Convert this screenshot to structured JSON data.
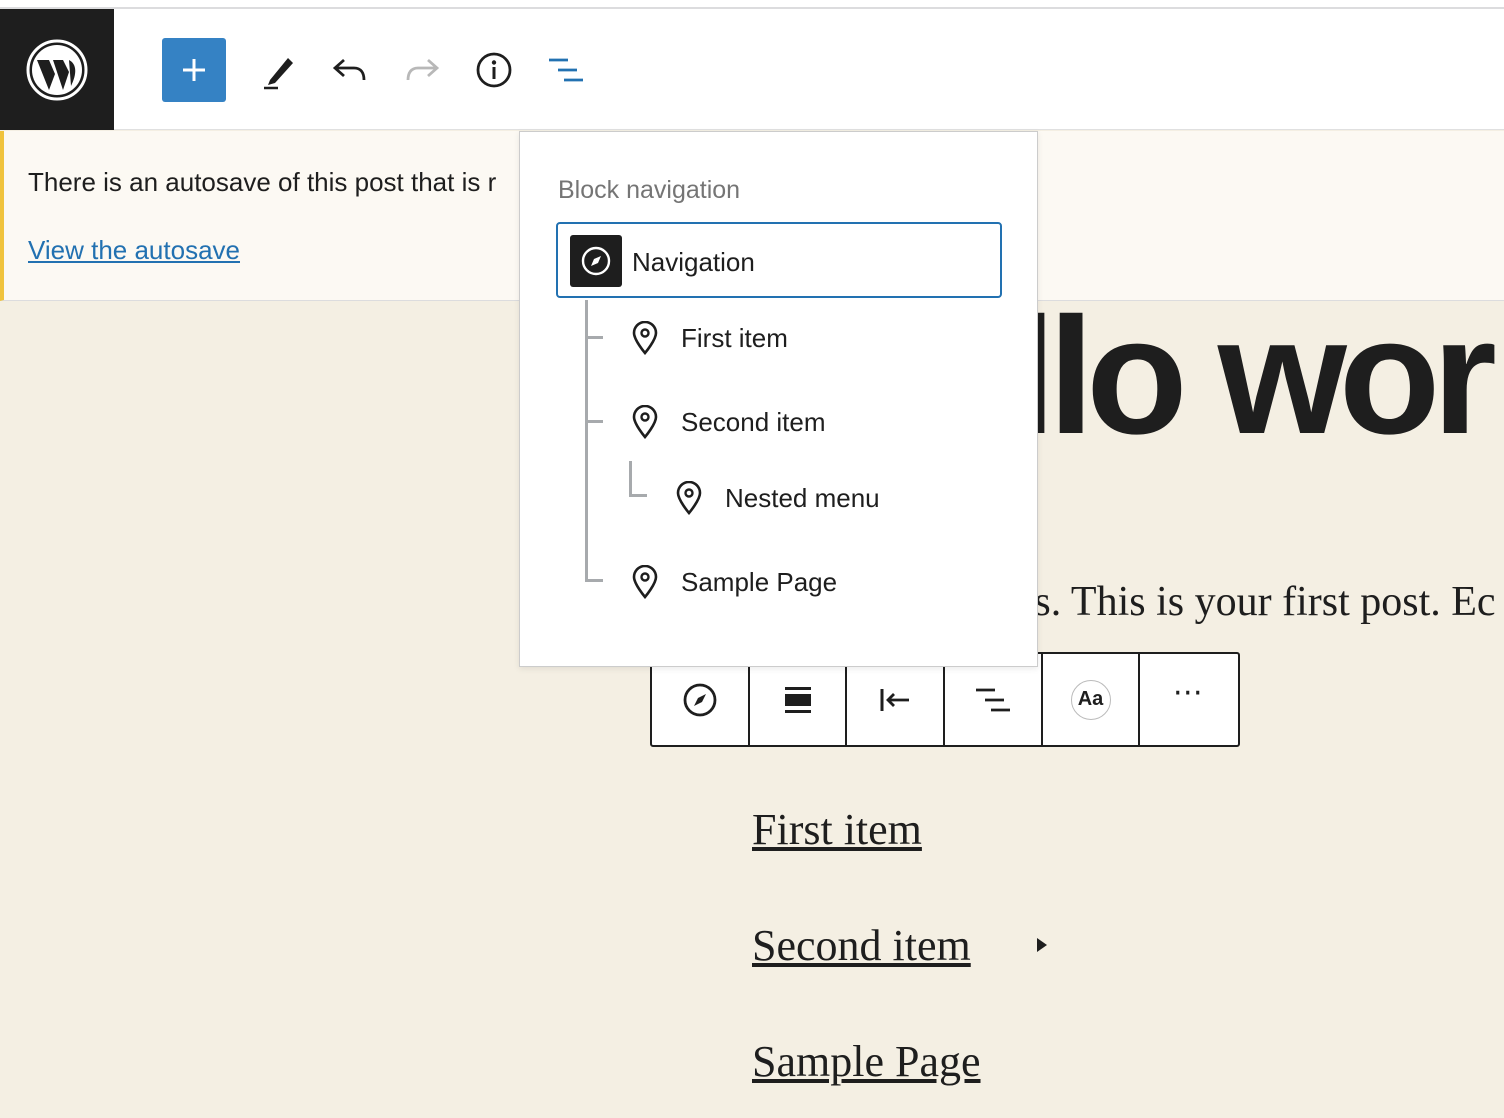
{
  "toolbar": {
    "logo": "wordpress-logo",
    "add_block": "plus-icon",
    "tools": "pencil-icon",
    "undo": "undo-icon",
    "redo": "redo-icon",
    "details": "info-icon",
    "block_navigation": "list-view-icon",
    "accent_color": "#3582c4"
  },
  "notice": {
    "text": "There is an autosave of this post that is r",
    "link": "View the autosave",
    "border_color": "#f0c33c"
  },
  "post": {
    "title_fragment": "llo wor",
    "paragraph_fragment": "ss. This is your first post. Ec"
  },
  "block_navigation": {
    "title": "Block navigation",
    "root": {
      "label": "Navigation",
      "icon": "compass-icon",
      "selected": true
    },
    "items": [
      {
        "label": "First item",
        "icon": "location-pin-icon",
        "depth": 1
      },
      {
        "label": "Second item",
        "icon": "location-pin-icon",
        "depth": 1
      },
      {
        "label": "Nested menu",
        "icon": "location-pin-icon",
        "depth": 2
      },
      {
        "label": "Sample Page",
        "icon": "location-pin-icon",
        "depth": 1
      }
    ]
  },
  "block_toolbar": {
    "buttons": [
      {
        "name": "navigation-block-icon",
        "icon": "compass-icon"
      },
      {
        "name": "align",
        "icon": "align-center-icon"
      },
      {
        "name": "justification",
        "icon": "justify-left-icon"
      },
      {
        "name": "block-navigation",
        "icon": "list-view-icon"
      },
      {
        "name": "text-settings",
        "label": "Aa"
      },
      {
        "name": "more-options",
        "label": "⋯"
      }
    ]
  },
  "nav_links": {
    "first": "First item",
    "second": "Second item",
    "third": "Sample Page"
  }
}
